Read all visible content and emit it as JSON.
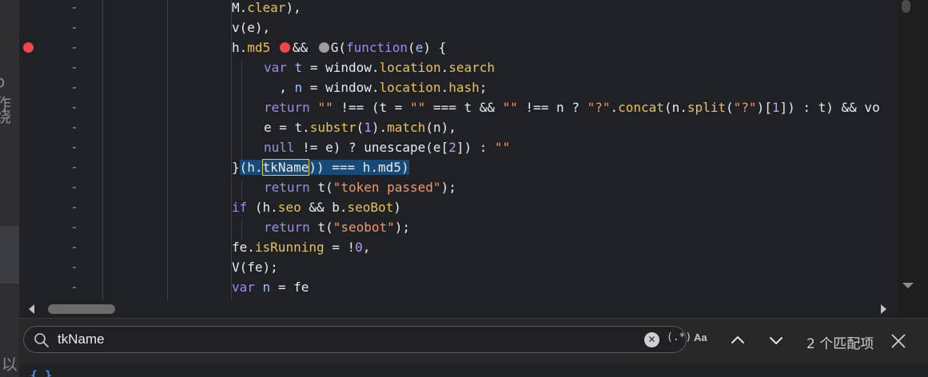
{
  "page_strip": {
    "glyphs": [
      "o作",
      "绕",
      "[以"
    ]
  },
  "editor": {
    "lines": [
      {
        "ln": "-",
        "breakpoint": false,
        "indent": 0,
        "tokens": [
          [
            "",
            "M."
          ],
          [
            "prop",
            "clear"
          ],
          [
            "",
            "),"
          ]
        ]
      },
      {
        "ln": "-",
        "breakpoint": false,
        "indent": 0,
        "tokens": [
          [
            "",
            "v(e),"
          ]
        ]
      },
      {
        "ln": "-",
        "breakpoint": true,
        "indent": 0,
        "tokens": [
          [
            "",
            "h."
          ],
          [
            "prop",
            "md5"
          ],
          [
            "",
            " "
          ],
          [
            "dotred",
            ""
          ],
          [
            "",
            "&& "
          ],
          [
            "dotgrey",
            ""
          ],
          [
            "",
            "G("
          ],
          [
            "kw",
            "function"
          ],
          [
            "",
            "("
          ],
          [
            "var",
            "e"
          ],
          [
            "",
            ") {"
          ]
        ]
      },
      {
        "ln": "-",
        "breakpoint": false,
        "indent": 1,
        "tokens": [
          [
            "kw",
            "var"
          ],
          [
            "",
            " "
          ],
          [
            "var",
            "t"
          ],
          [
            "",
            " = window."
          ],
          [
            "prop",
            "location"
          ],
          [
            "",
            "."
          ],
          [
            "prop",
            "search"
          ]
        ]
      },
      {
        "ln": "-",
        "breakpoint": false,
        "indent": 1,
        "tokens": [
          [
            "",
            "  , "
          ],
          [
            "var",
            "n"
          ],
          [
            "",
            " = window."
          ],
          [
            "prop",
            "location"
          ],
          [
            "",
            "."
          ],
          [
            "prop",
            "hash"
          ],
          [
            "",
            ";"
          ]
        ]
      },
      {
        "ln": "-",
        "breakpoint": false,
        "indent": 1,
        "tokens": [
          [
            "kw",
            "return"
          ],
          [
            "",
            " "
          ],
          [
            "str",
            "\"\""
          ],
          [
            "",
            " !== (t = "
          ],
          [
            "str",
            "\"\""
          ],
          [
            "",
            " === t && "
          ],
          [
            "str",
            "\"\""
          ],
          [
            "",
            " !== n ? "
          ],
          [
            "str",
            "\"?\""
          ],
          [
            "",
            "."
          ],
          [
            "prop",
            "concat"
          ],
          [
            "",
            "(n."
          ],
          [
            "prop",
            "split"
          ],
          [
            "",
            "("
          ],
          [
            "str",
            "\"?\""
          ],
          [
            "",
            ")["
          ],
          [
            "num",
            "1"
          ],
          [
            "",
            "]) : t) && vo"
          ]
        ]
      },
      {
        "ln": "-",
        "breakpoint": false,
        "indent": 1,
        "tokens": [
          [
            "",
            "e = t."
          ],
          [
            "prop",
            "substr"
          ],
          [
            "",
            "("
          ],
          [
            "num",
            "1"
          ],
          [
            "",
            ")."
          ],
          [
            "prop",
            "match"
          ],
          [
            "",
            "(n),"
          ]
        ]
      },
      {
        "ln": "-",
        "breakpoint": false,
        "indent": 1,
        "tokens": [
          [
            "kw",
            "null"
          ],
          [
            "",
            " != e) ? unescape(e["
          ],
          [
            "num",
            "2"
          ],
          [
            "",
            "]) : "
          ],
          [
            "str",
            "\"\""
          ]
        ]
      },
      {
        "ln": "-",
        "breakpoint": false,
        "indent": 0,
        "tokens": [
          [
            "",
            "}"
          ],
          [
            "sel",
            "(h."
          ],
          [
            "match",
            "tkName"
          ],
          [
            "sel",
            ")) === h.md5)"
          ]
        ]
      },
      {
        "ln": "-",
        "breakpoint": false,
        "indent": 1,
        "tokens": [
          [
            "kw",
            "return"
          ],
          [
            "",
            " t("
          ],
          [
            "str",
            "\"token passed\""
          ],
          [
            "",
            ");"
          ]
        ]
      },
      {
        "ln": "-",
        "breakpoint": false,
        "indent": 0,
        "tokens": [
          [
            "kw",
            "if"
          ],
          [
            "",
            " (h."
          ],
          [
            "prop",
            "seo"
          ],
          [
            "",
            " && b."
          ],
          [
            "prop",
            "seoBot"
          ],
          [
            "",
            ")"
          ]
        ]
      },
      {
        "ln": "-",
        "breakpoint": false,
        "indent": 1,
        "tokens": [
          [
            "kw",
            "return"
          ],
          [
            "",
            " t("
          ],
          [
            "str",
            "\"seobot\""
          ],
          [
            "",
            ");"
          ]
        ]
      },
      {
        "ln": "-",
        "breakpoint": false,
        "indent": 0,
        "tokens": [
          [
            "",
            "fe."
          ],
          [
            "prop",
            "isRunning"
          ],
          [
            "",
            " = !"
          ],
          [
            "num",
            "0"
          ],
          [
            "",
            ","
          ]
        ]
      },
      {
        "ln": "-",
        "breakpoint": false,
        "indent": 0,
        "tokens": [
          [
            "",
            "V(fe);"
          ]
        ]
      },
      {
        "ln": "-",
        "breakpoint": false,
        "indent": 0,
        "tokens": [
          [
            "kw",
            "var"
          ],
          [
            "",
            " "
          ],
          [
            "var",
            "n"
          ],
          [
            "",
            " = fe"
          ]
        ]
      }
    ]
  },
  "search": {
    "value": "tkName",
    "regex_label": "(.*)",
    "case_label": "Aa",
    "match_count": "2 个匹配项"
  },
  "bottom_peek": {
    "brace": "{ }",
    "text": "   ..."
  },
  "colors": {
    "keyword": "#9b8cf0",
    "property": "#e5c15f",
    "string": "#f29766",
    "number": "#b79cf8",
    "breakpoint": "#f1444c"
  },
  "icons": [
    "search-icon",
    "clear-icon",
    "regex-icon",
    "match-case-icon",
    "chevron-up-icon",
    "chevron-down-icon",
    "close-icon",
    "breakpoint-icon"
  ]
}
